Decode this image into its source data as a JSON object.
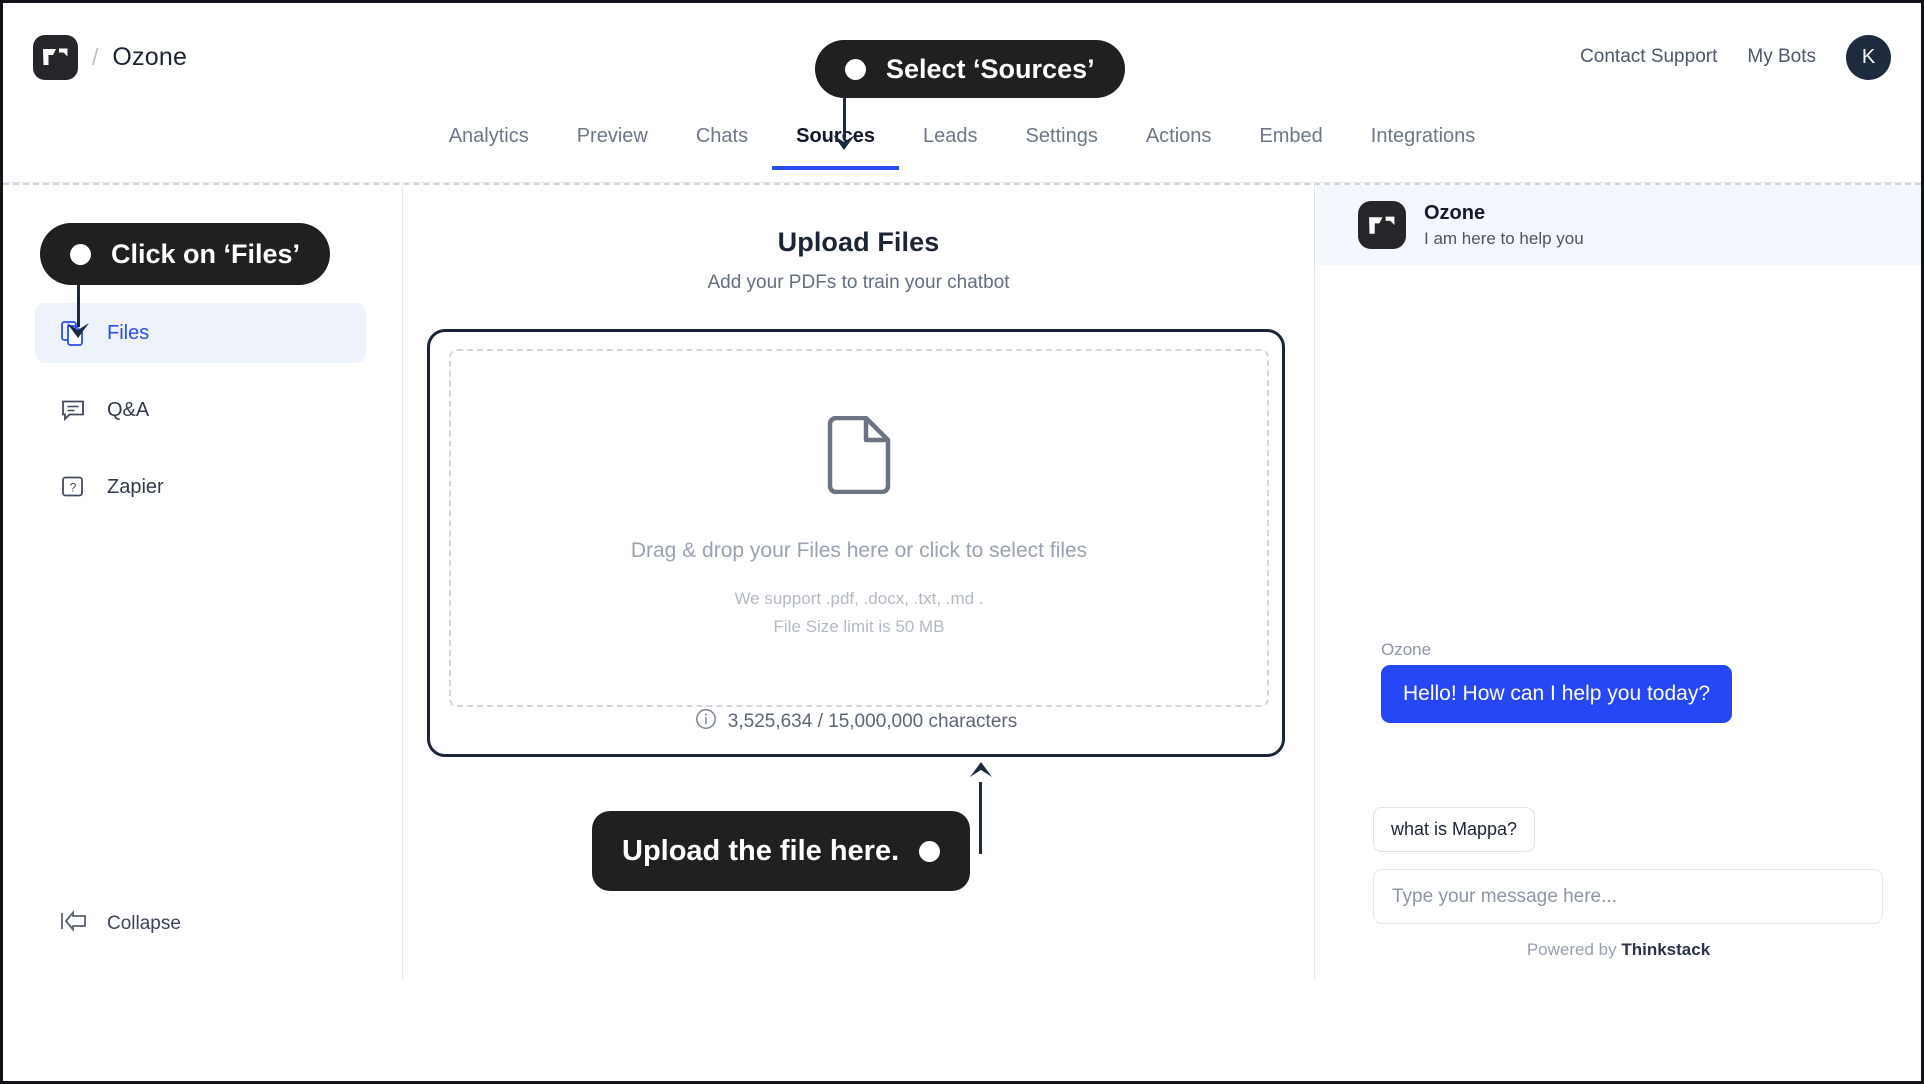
{
  "header": {
    "logo_icon": "thinkstack-logo-icon",
    "separator": "/",
    "bot_name": "Ozone",
    "links": [
      {
        "label": "Contact Support",
        "name": "contact-support-link"
      },
      {
        "label": "My Bots",
        "name": "my-bots-link"
      }
    ],
    "avatar_initial": "K"
  },
  "tabs": [
    {
      "label": "Analytics",
      "active": false
    },
    {
      "label": "Preview",
      "active": false
    },
    {
      "label": "Chats",
      "active": false
    },
    {
      "label": "Sources",
      "active": true
    },
    {
      "label": "Leads",
      "active": false
    },
    {
      "label": "Settings",
      "active": false
    },
    {
      "label": "Actions",
      "active": false
    },
    {
      "label": "Embed",
      "active": false
    },
    {
      "label": "Integrations",
      "active": false
    }
  ],
  "sidebar": {
    "items": [
      {
        "label": "Files",
        "icon": "files-copy-icon",
        "active": true
      },
      {
        "label": "Q&A",
        "icon": "chat-bubble-icon",
        "active": false
      },
      {
        "label": "Zapier",
        "icon": "question-square-icon",
        "active": false
      }
    ],
    "collapse_label": "Collapse",
    "collapse_icon": "collapse-left-arrow-icon"
  },
  "upload": {
    "title": "Upload Files",
    "subtitle": "Add your PDFs to train your chatbot",
    "dropzone_icon": "document-file-icon",
    "dropzone_main": "Drag & drop your Files here or click to select files",
    "dropzone_note_line1": "We support .pdf, .docx, .txt, .md .",
    "dropzone_note_line2": "File Size limit is 50 MB",
    "counter_icon": "info-circle-icon",
    "counter_text": "3,525,634 / 15,000,000 characters",
    "characters_used": "3,525,634",
    "characters_limit": "15,000,000"
  },
  "chat_widget": {
    "header_logo_icon": "thinkstack-logo-icon",
    "header_name": "Ozone",
    "header_subtitle": "I am here to help you",
    "message_sender": "Ozone",
    "message_text": "Hello! How can I help you today?",
    "suggestion": "what is Mappa?",
    "input_placeholder": "Type your message here...",
    "footer_prefix": "Powered by ",
    "footer_brand": "Thinkstack"
  },
  "callouts": [
    {
      "text": "Select ‘Sources’",
      "name": "callout-select-sources"
    },
    {
      "text": "Click on ‘Files’",
      "name": "callout-click-files"
    },
    {
      "text": "Upload the file here.",
      "name": "callout-upload-here"
    }
  ],
  "colors": {
    "accent_blue": "#2a4df0",
    "bubble_blue": "#2547f5",
    "callout_dark": "#221f20",
    "sidebar_active_bg": "#eef2fa"
  }
}
